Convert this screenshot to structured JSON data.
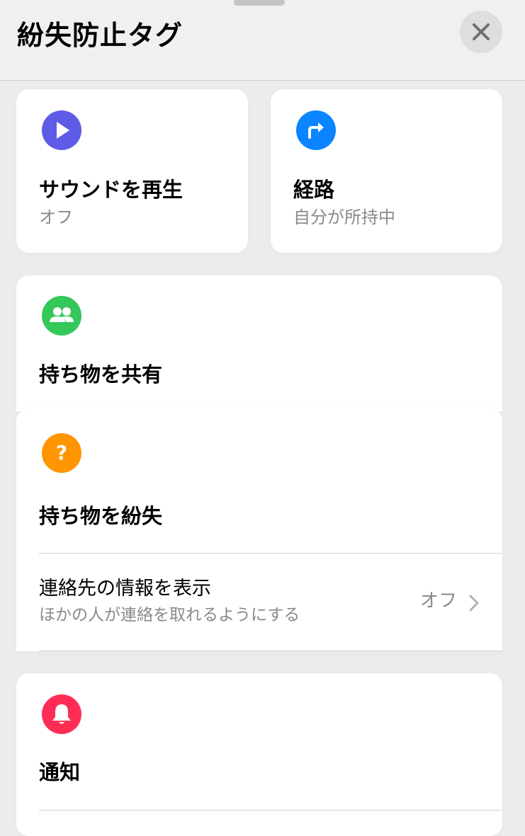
{
  "header": {
    "title": "紛失防止タグ"
  },
  "actions": {
    "sound": {
      "title": "サウンドを再生",
      "subtitle": "オフ",
      "icon": "play-icon",
      "color": "#5E5CE6"
    },
    "directions": {
      "title": "経路",
      "subtitle": "自分が所持中",
      "icon": "turn-right-arrow-icon",
      "color": "#0A84FF"
    }
  },
  "share": {
    "title": "持ち物を共有",
    "icon": "people-icon",
    "color": "#34C759"
  },
  "lost": {
    "title": "持ち物を紛失",
    "icon": "question-mark-icon",
    "color": "#FF9500",
    "contact_row": {
      "title": "連絡先の情報を表示",
      "subtitle": "ほかの人が連絡を取れるようにする",
      "value": "オフ"
    }
  },
  "notifications": {
    "title": "通知",
    "icon": "bell-icon",
    "color": "#FF2D55"
  }
}
